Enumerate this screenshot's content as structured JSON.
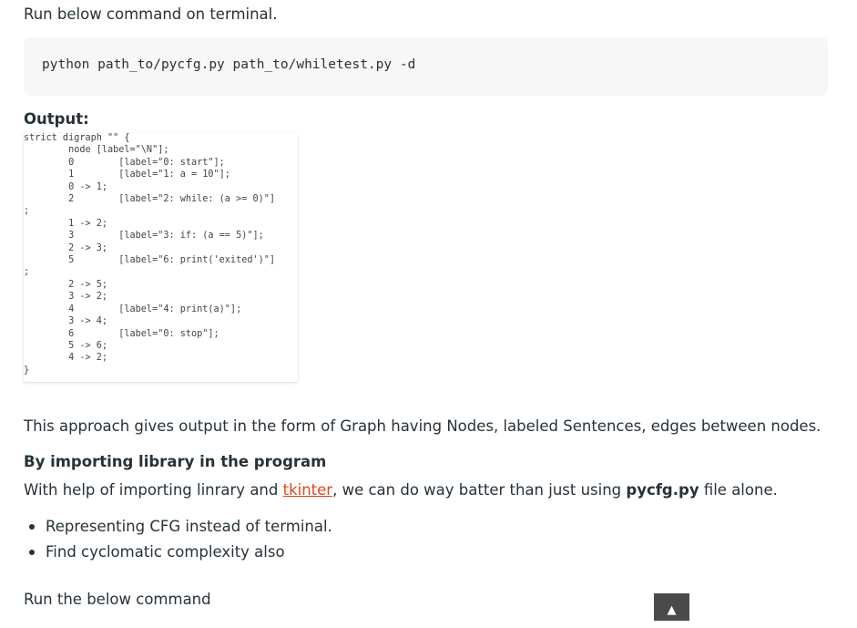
{
  "article": {
    "intro": "Run below command on terminal.",
    "command": "python path_to/pycfg.py path_to/whiletest.py -d",
    "output_heading": "Output:",
    "output_lines": [
      "strict digraph \"\" {",
      "        node [label=\"\\N\"];",
      "        0        [label=\"0: start\"];",
      "        1        [label=\"1: a = 10\"];",
      "        0 -> 1;",
      "        2        [label=\"2: while: (a >= 0)\"]",
      ";",
      "        1 -> 2;",
      "        3        [label=\"3: if: (a == 5)\"];",
      "        2 -> 3;",
      "        5        [label=\"6: print('exited')\"]",
      ";",
      "        2 -> 5;",
      "        3 -> 2;",
      "        4        [label=\"4: print(a)\"];",
      "        3 -> 4;",
      "        6        [label=\"0: stop\"];",
      "        5 -> 6;",
      "        4 -> 2;",
      "}"
    ],
    "approach_text": "This approach gives output in the form of Graph having Nodes, labeled Sentences, edges between nodes.",
    "library_heading": "By importing library in the program",
    "library_text_before": "With help of importing linrary and ",
    "library_link": "tkinter",
    "library_text_mid": ", we can do way batter than just using ",
    "library_bold": "pycfg.py",
    "library_text_after": " file alone.",
    "bullets": [
      "Representing CFG instead of terminal.",
      "Find cyclomatic complexity also"
    ],
    "run_below": "Run the below command"
  },
  "scroll_top": {
    "glyph": "▲"
  }
}
